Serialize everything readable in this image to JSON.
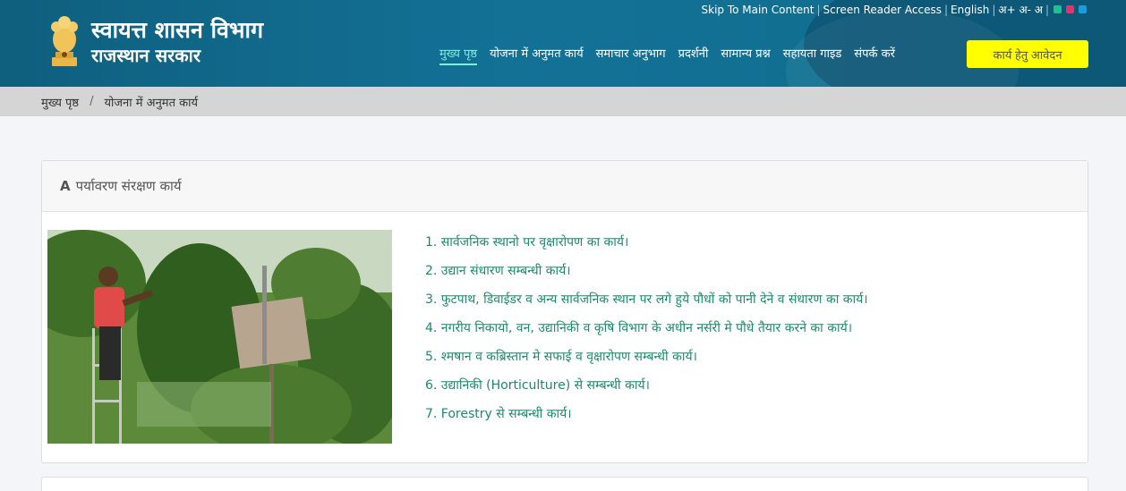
{
  "header": {
    "title": "स्वायत्त शासन विभाग",
    "subtitle": "राजस्थान सरकार",
    "logo_icon": "state-emblem-icon"
  },
  "toplinks": {
    "skip": "Skip To Main Content",
    "screen_reader": "Screen Reader Access",
    "language": "English",
    "font_sizes": "अ+ अ- अ",
    "theme_colors": [
      "#1fbf8f",
      "#e0356a",
      "#1a9de0"
    ]
  },
  "nav": {
    "items": [
      {
        "label": "मुख्य पृष्ठ",
        "active": true
      },
      {
        "label": "योजना में अनुमत कार्य",
        "active": false
      },
      {
        "label": "समाचार अनुभाग",
        "active": false
      },
      {
        "label": "प्रदर्शनी",
        "active": false
      },
      {
        "label": "सामान्य प्रश्न",
        "active": false
      },
      {
        "label": "सहायता गाइड",
        "active": false
      },
      {
        "label": "संपर्क करें",
        "active": false
      }
    ],
    "apply_label": "कार्य हेतु आवेदन"
  },
  "breadcrumb": {
    "home": "मुख्य पृष्ठ",
    "separator": "/",
    "current": "योजना में अनुमत कार्य"
  },
  "section": {
    "letter": "A",
    "title": "पर्यावरण संरक्षण कार्य",
    "items": [
      "1. सार्वजनिक स्थानो पर वृक्षारोपण का कार्य।",
      "2. उद्यान संधारण सम्बन्धी कार्य।",
      "3. फुटपाथ, डिवाईडर व अन्य सार्वजनिक स्थान पर लगे हुये पौधों को पानी देने व संधारण का कार्य।",
      "4. नगरीय निकायो, वन, उद्यानिकी व कृषि विभाग के अधीन नर्सरी मे पौधे तैयार करने का कार्य।",
      "5. श्मषान व कब्रिस्तान मे सफाई व वृक्षारोपण सम्बन्धी कार्य।",
      "6. उद्यानिकी (Horticulture) से सम्बन्धी कार्य।",
      "7. Forestry से सम्बन्धी कार्य।"
    ]
  },
  "colors": {
    "header_bg": "#137196",
    "accent": "#7df0d7",
    "apply_bg": "#ffff00",
    "list_text": "#1b8a6b"
  }
}
